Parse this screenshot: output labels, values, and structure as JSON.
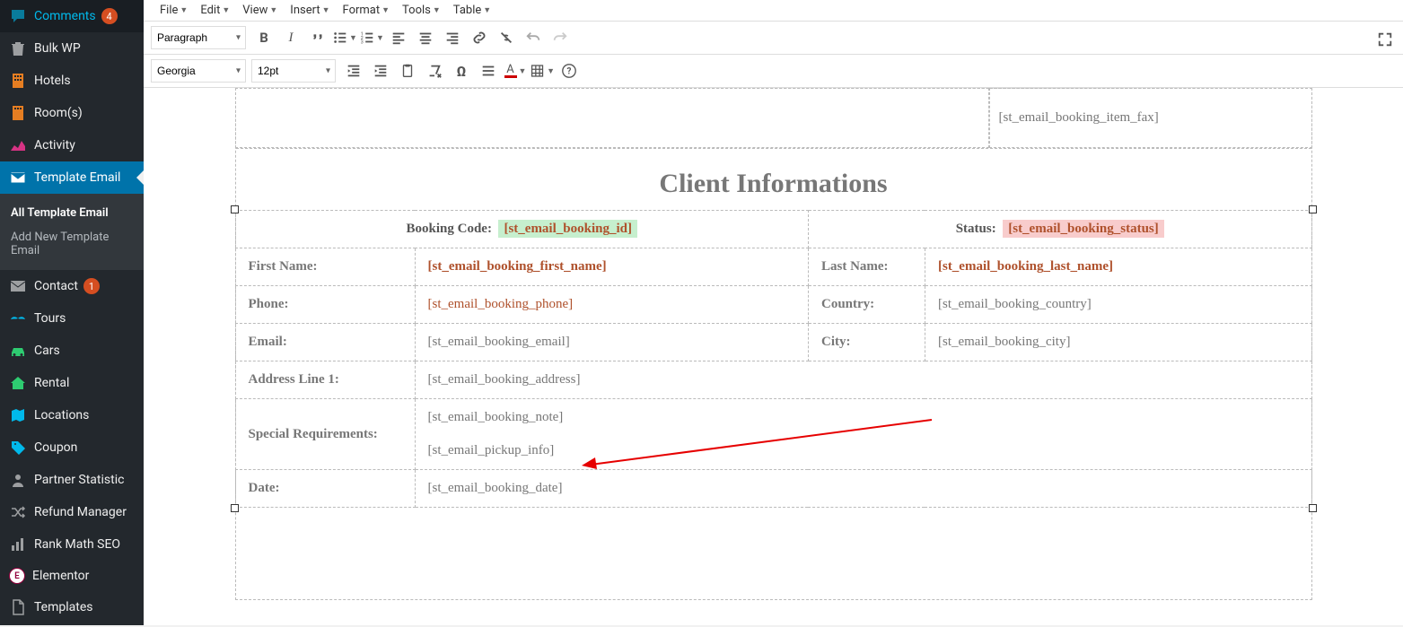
{
  "sidebar": {
    "comments": {
      "label": "Comments",
      "badge": "4"
    },
    "bulkwp": {
      "label": "Bulk WP"
    },
    "hotels": {
      "label": "Hotels"
    },
    "rooms": {
      "label": "Room(s)"
    },
    "activity": {
      "label": "Activity"
    },
    "template_email": {
      "label": "Template Email"
    },
    "sub": {
      "all": "All Template Email",
      "add": "Add New Template Email"
    },
    "contact": {
      "label": "Contact",
      "badge": "1"
    },
    "tours": {
      "label": "Tours"
    },
    "cars": {
      "label": "Cars"
    },
    "rental": {
      "label": "Rental"
    },
    "locations": {
      "label": "Locations"
    },
    "coupon": {
      "label": "Coupon"
    },
    "partner": {
      "label": "Partner Statistic"
    },
    "refund": {
      "label": "Refund Manager"
    },
    "rankmath": {
      "label": "Rank Math SEO"
    },
    "elementor": {
      "label": "Elementor"
    },
    "templates": {
      "label": "Templates"
    }
  },
  "menus": [
    "File",
    "Edit",
    "View",
    "Insert",
    "Format",
    "Tools",
    "Table"
  ],
  "toolbar": {
    "block_format": "Paragraph",
    "font_family": "Georgia",
    "font_size": "12pt"
  },
  "content": {
    "top_right": "[st_email_booking_item_fax]",
    "heading": "Client Informations",
    "rows": {
      "booking_code_lbl": "Booking Code:",
      "booking_code_val": "[st_email_booking_id]",
      "status_lbl": "Status:",
      "status_val": "[st_email_booking_status]",
      "first_name_lbl": "First Name:",
      "first_name_val": "[st_email_booking_first_name]",
      "last_name_lbl": "Last Name:",
      "last_name_val": "[st_email_booking_last_name]",
      "phone_lbl": "Phone:",
      "phone_val": "[st_email_booking_phone]",
      "country_lbl": "Country:",
      "country_val": "[st_email_booking_country]",
      "email_lbl": "Email:",
      "email_val": "[st_email_booking_email]",
      "city_lbl": "City:",
      "city_val": "[st_email_booking_city]",
      "addr_lbl": "Address Line 1:",
      "addr_val": "[st_email_booking_address]",
      "spec_lbl": "Special Requirements:",
      "spec_val1": "[st_email_booking_note]",
      "spec_val2": "[st_email_pickup_info]",
      "date_lbl": "Date:",
      "date_val": "[st_email_booking_date]"
    }
  }
}
